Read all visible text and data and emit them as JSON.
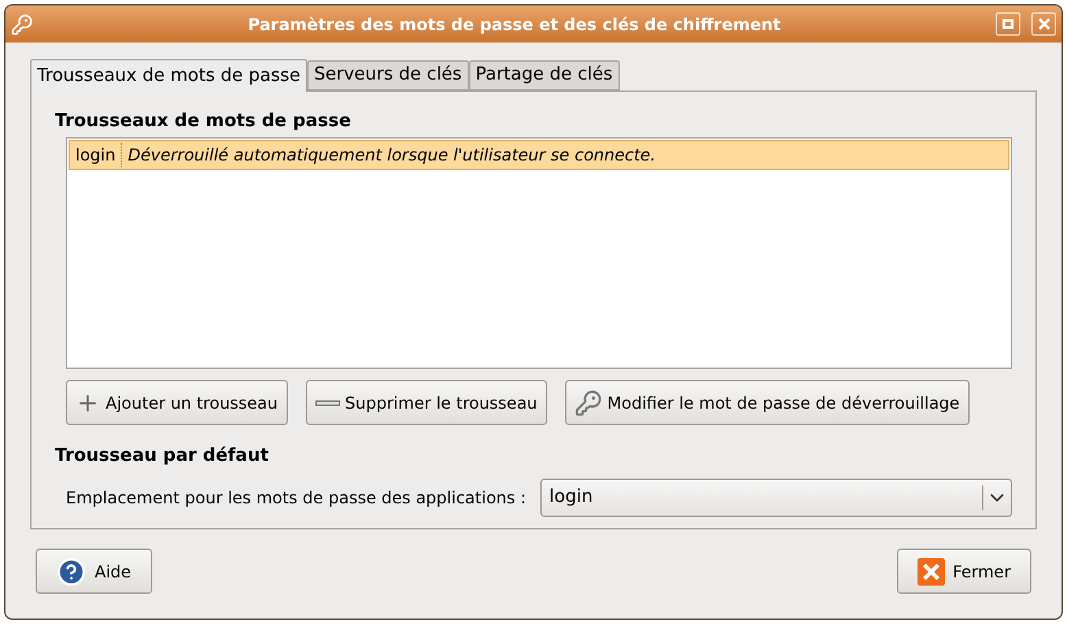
{
  "window": {
    "title": "Paramètres des mots de passe et des clés de chiffrement"
  },
  "tabs": [
    {
      "label": "Trousseaux de mots de passe",
      "selected": true
    },
    {
      "label": "Serveurs de clés",
      "selected": false
    },
    {
      "label": "Partage de clés",
      "selected": false
    }
  ],
  "keyrings": {
    "heading": "Trousseaux de mots de passe",
    "rows": [
      {
        "name": "login",
        "description": "Déverrouillé automatiquement lorsque l'utilisateur se connecte.",
        "selected": true
      }
    ]
  },
  "keyring_buttons": [
    {
      "kind": "add",
      "label": "Ajouter un trousseau"
    },
    {
      "kind": "remove",
      "label": "Supprimer le trousseau"
    },
    {
      "kind": "password",
      "label": "Modifier le mot de passe de déverrouillage"
    }
  ],
  "default_keyring": {
    "heading": "Trousseau par défaut",
    "label": "Emplacement pour les mots de passe des applications :",
    "value": "login"
  },
  "buttons": [
    {
      "kind": "help",
      "label": "Aide"
    },
    {
      "kind": "close",
      "label": "Fermer"
    }
  ]
}
